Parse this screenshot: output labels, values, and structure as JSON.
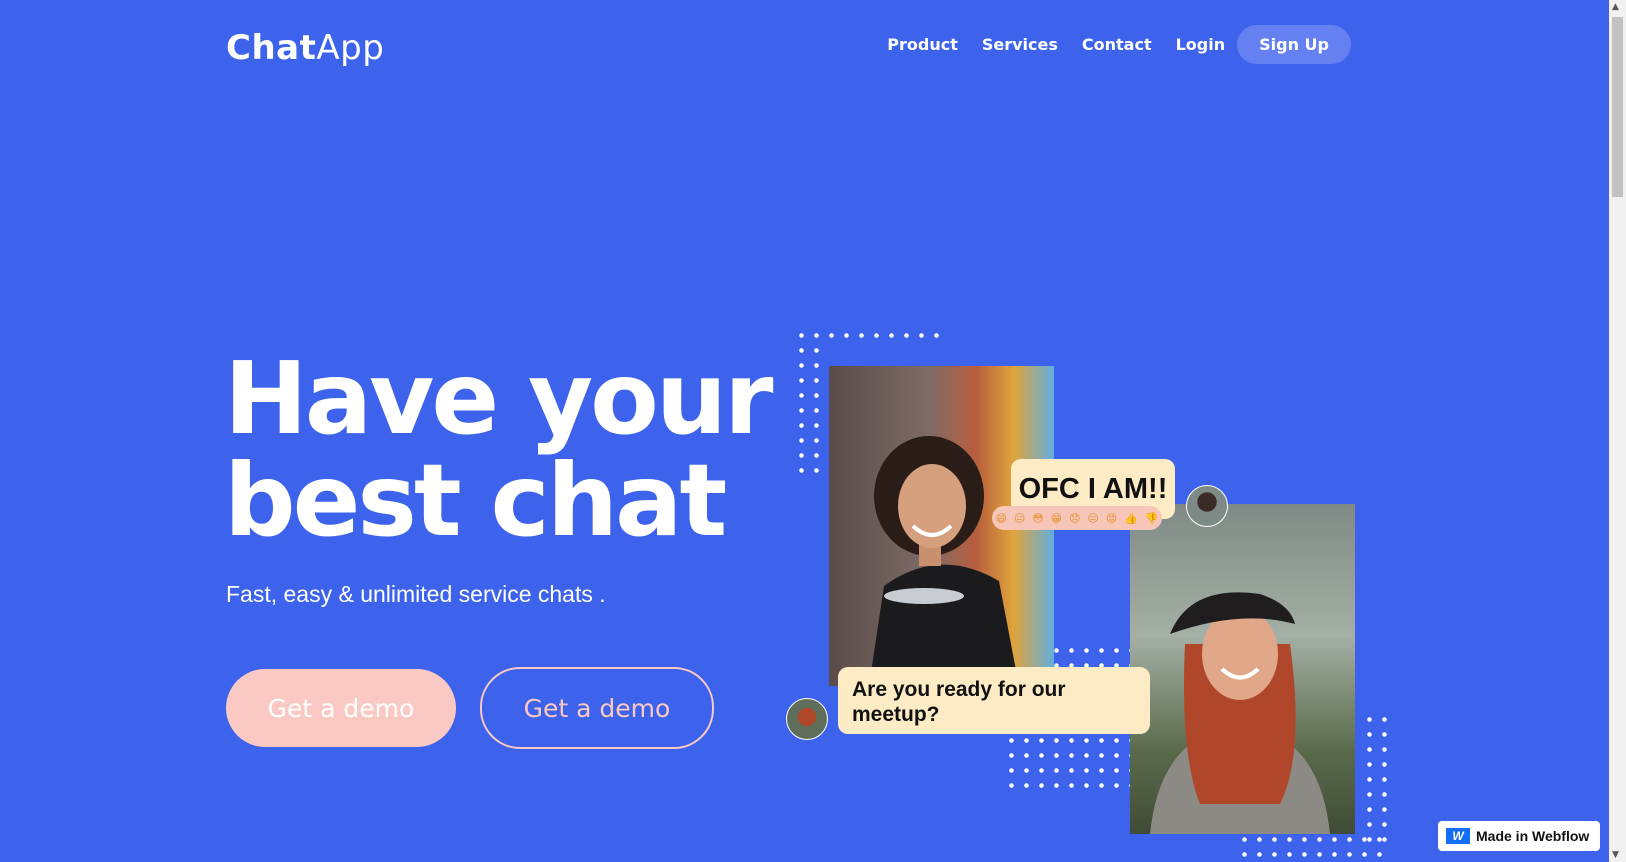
{
  "header": {
    "logo_bold": "Chat",
    "logo_light": "App",
    "nav": [
      "Product",
      "Services",
      "Contact",
      "Login"
    ],
    "signup_label": "Sign Up"
  },
  "hero": {
    "title_line1": "Have your",
    "title_line2": "best chat",
    "subtitle": "Fast, easy & unlimited service chats .",
    "primary_button": "Get a demo",
    "secondary_button": "Get a demo"
  },
  "chat": {
    "bubble1": "OFC I AM!!",
    "bubble2": "Are you ready for our meetup?",
    "emoji_row": [
      "😄",
      "😐",
      "😳",
      "😁",
      "😞",
      "😑",
      "😡",
      "👍",
      "👎"
    ]
  },
  "badge": {
    "label": "Made in Webflow",
    "icon": "webflow-logo-icon"
  },
  "colors": {
    "background": "#3d62ec",
    "accent": "#fac9c3",
    "bubble": "#fdebc5"
  }
}
